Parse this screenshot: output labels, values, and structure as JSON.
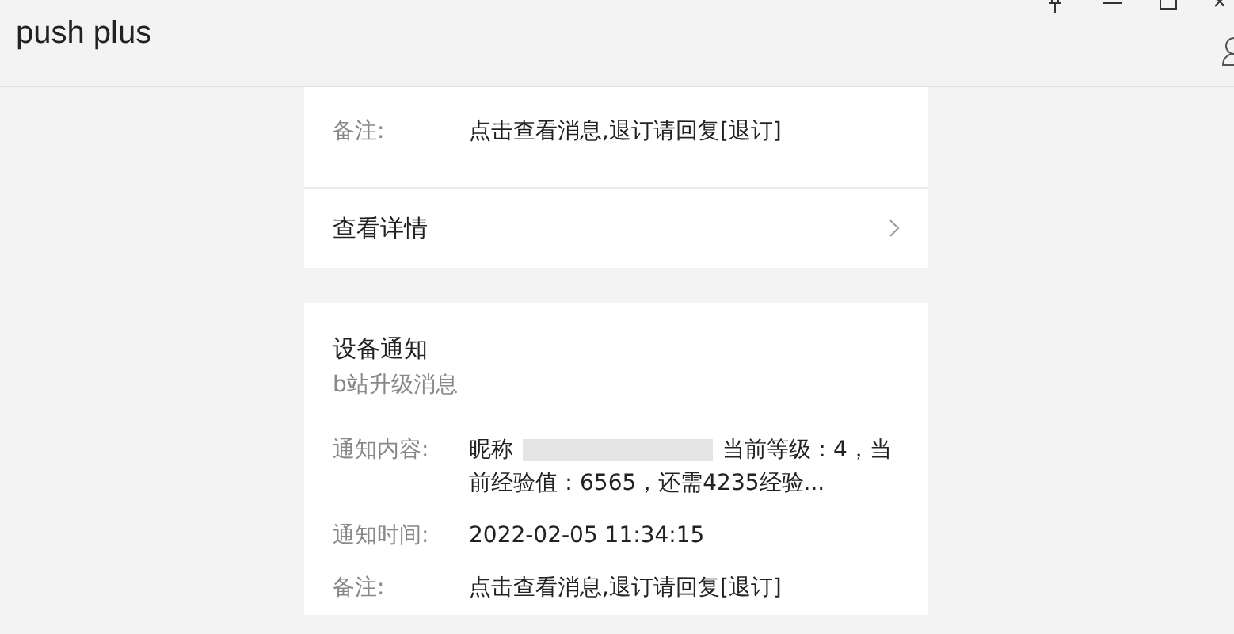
{
  "window": {
    "title": "push plus"
  },
  "cards": [
    {
      "rows": [
        {
          "label": "备注:",
          "value": "点击查看消息,退订请回复[退订]"
        }
      ],
      "link": "查看详情"
    },
    {
      "title": "设备通知",
      "subtitle": "b站升级消息",
      "content_label": "通知内容:",
      "content_start": "昵称",
      "content_rest": "当前等级：4，当前经验值：6565，还需4235经验...",
      "rows": [
        {
          "label": "通知时间:",
          "value": "2022-02-05 11:34:15"
        },
        {
          "label": "备注:",
          "value": "点击查看消息,退订请回复[退订]"
        }
      ]
    }
  ]
}
